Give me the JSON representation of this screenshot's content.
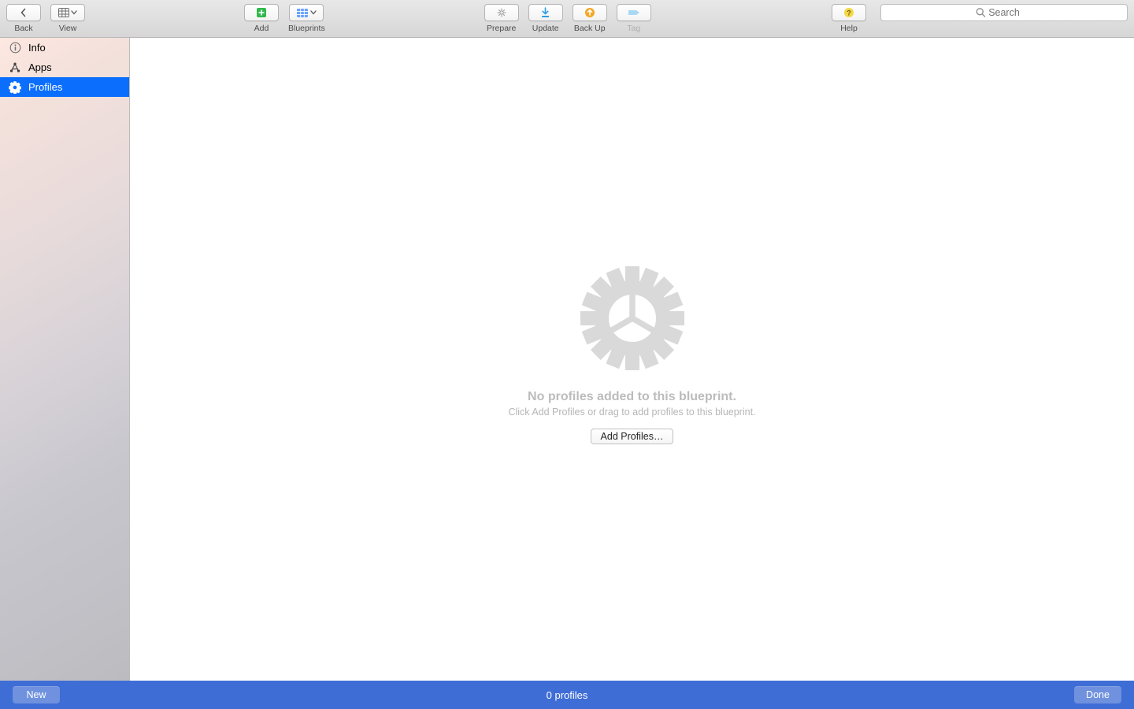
{
  "toolbar": {
    "back": {
      "label": "Back"
    },
    "view": {
      "label": "View"
    },
    "add": {
      "label": "Add"
    },
    "blueprints": {
      "label": "Blueprints"
    },
    "prepare": {
      "label": "Prepare"
    },
    "update": {
      "label": "Update"
    },
    "backup": {
      "label": "Back Up"
    },
    "tag": {
      "label": "Tag"
    },
    "help": {
      "label": "Help"
    },
    "search": {
      "placeholder": "Search"
    }
  },
  "sidebar": {
    "items": [
      {
        "id": "info",
        "label": "Info",
        "selected": false
      },
      {
        "id": "apps",
        "label": "Apps",
        "selected": false
      },
      {
        "id": "profiles",
        "label": "Profiles",
        "selected": true
      }
    ]
  },
  "empty": {
    "title": "No profiles added to this blueprint.",
    "subtitle": "Click Add Profiles or drag to add profiles to this blueprint.",
    "button": "Add Profiles…"
  },
  "bottombar": {
    "new_label": "New",
    "status": "0 profiles",
    "done_label": "Done"
  },
  "colors": {
    "accent": "#0b6efc",
    "bottom": "#3f6dd6"
  }
}
